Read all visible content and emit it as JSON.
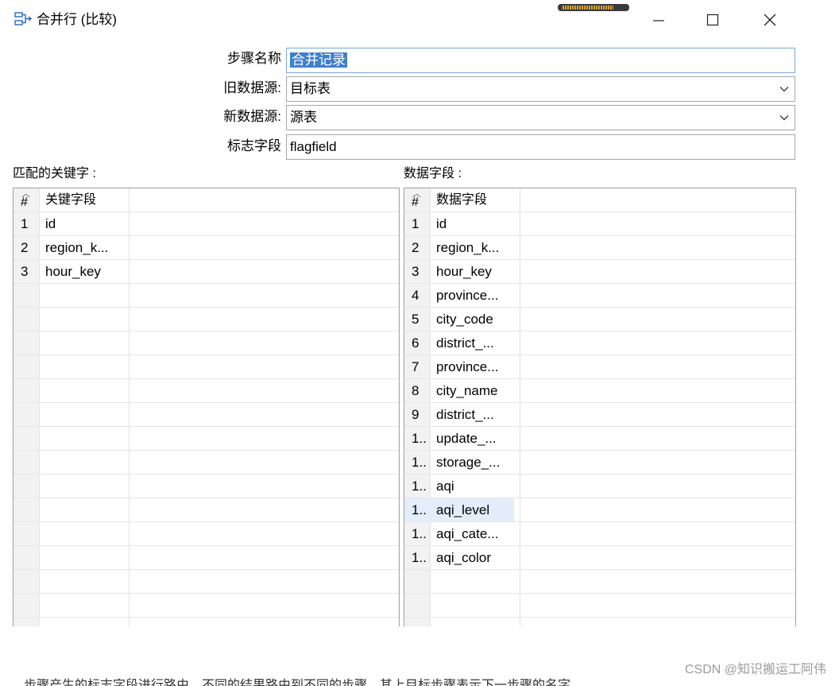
{
  "window": {
    "title": "合并行 (比较)"
  },
  "form": {
    "step_name": {
      "label": "步骤名称",
      "value": "合并记录"
    },
    "old_source": {
      "label": "旧数据源:",
      "value": "目标表"
    },
    "new_source": {
      "label": "新数据源:",
      "value": "源表"
    },
    "flag_field": {
      "label": "标志字段",
      "value": "flagfield"
    }
  },
  "keys_table": {
    "section_label": "匹配的关键字 :",
    "columns": [
      "#",
      "关键字段"
    ],
    "rows": [
      {
        "num": "1",
        "value": "id"
      },
      {
        "num": "2",
        "value": "region_k..."
      },
      {
        "num": "3",
        "value": "hour_key"
      }
    ]
  },
  "values_table": {
    "section_label": "数据字段 :",
    "columns": [
      "#",
      "数据字段"
    ],
    "selected_index": 12,
    "rows": [
      {
        "num": "1",
        "value": "id"
      },
      {
        "num": "2",
        "value": "region_k..."
      },
      {
        "num": "3",
        "value": "hour_key"
      },
      {
        "num": "4",
        "value": "province..."
      },
      {
        "num": "5",
        "value": "city_code"
      },
      {
        "num": "6",
        "value": "district_..."
      },
      {
        "num": "7",
        "value": "province..."
      },
      {
        "num": "8",
        "value": "city_name"
      },
      {
        "num": "9",
        "value": "district_..."
      },
      {
        "num": "1..",
        "value": "update_..."
      },
      {
        "num": "1..",
        "value": "storage_..."
      },
      {
        "num": "1..",
        "value": "aqi"
      },
      {
        "num": "1..",
        "value": "aqi_level"
      },
      {
        "num": "1..",
        "value": "aqi_cate..."
      },
      {
        "num": "1..",
        "value": "aqi_color"
      }
    ]
  },
  "footer": {
    "watermark": "CSDN @知识搬运工阿伟",
    "cut_text": "步骤产生的标志字段进行路由，不同的结果路由到不同的步骤，其上目标步骤表示下一步骤的名字"
  }
}
